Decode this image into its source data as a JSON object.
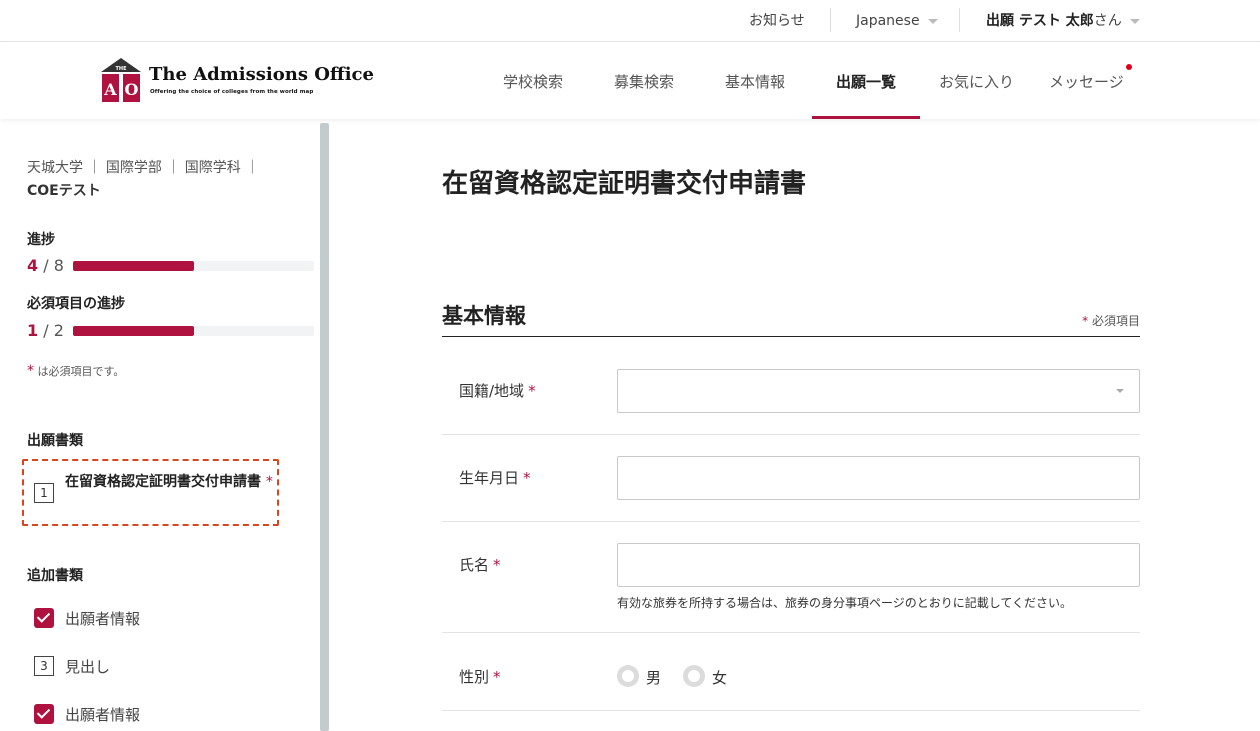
{
  "topbar": {
    "news": "お知らせ",
    "language": "Japanese",
    "user_name": "出願 テスト 太郎",
    "user_suffix": "さん"
  },
  "logo": {
    "mark_top": "THE",
    "mark_a": "A",
    "mark_o": "O",
    "title": "The Admissions Office",
    "subtitle": "Offering the choice of colleges from the world map"
  },
  "nav": {
    "items": [
      {
        "label": "学校検索"
      },
      {
        "label": "募集検索"
      },
      {
        "label": "基本情報"
      },
      {
        "label": "出願一覧"
      },
      {
        "label": "お気に入り"
      },
      {
        "label": "メッセージ"
      }
    ],
    "active": "出願一覧"
  },
  "sidebar": {
    "breadcrumb": "天城大学 ｜ 国際学部 ｜ 国際学科 ｜",
    "program": "COEテスト",
    "progress": {
      "label": "進捗",
      "current": "4",
      "sep": " / ",
      "total": "8",
      "fraction": 0.5
    },
    "required_progress": {
      "label": "必須項目の進捗",
      "current": "1",
      "sep": " / ",
      "total": "2",
      "fraction": 0.5
    },
    "required_note_star": "*",
    "required_note": " は必須項目です。",
    "application_docs_heading": "出願書類",
    "application_docs": [
      {
        "number": "1",
        "label": "在留資格認定証明書交付申請書",
        "required_mark": "*"
      }
    ],
    "additional_docs_heading": "追加書類",
    "additional_docs": [
      {
        "status": "checked",
        "label": "出願者情報"
      },
      {
        "status": "numbered",
        "number": "3",
        "label": "見出し"
      },
      {
        "status": "checked",
        "label": "出願者情報"
      }
    ]
  },
  "main": {
    "page_title": "在留資格認定証明書交付申請書",
    "section_title": "基本情報",
    "required_legend_star": "*",
    "required_legend": " 必須項目",
    "fields": {
      "nationality": {
        "label": "国籍/地域",
        "value": ""
      },
      "birthdate": {
        "label": "生年月日",
        "value": ""
      },
      "name": {
        "label": "氏名",
        "value": "",
        "help": "有効な旅券を所持する場合は、旅券の身分事項ページのとおりに記載してください。"
      },
      "gender": {
        "label": "性別",
        "options": [
          "男",
          "女"
        ],
        "selected": ""
      }
    },
    "required_mark": "*"
  },
  "colors": {
    "accent": "#b0123f",
    "highlight_border": "#d9451d",
    "notification_dot": "#e0001b"
  }
}
